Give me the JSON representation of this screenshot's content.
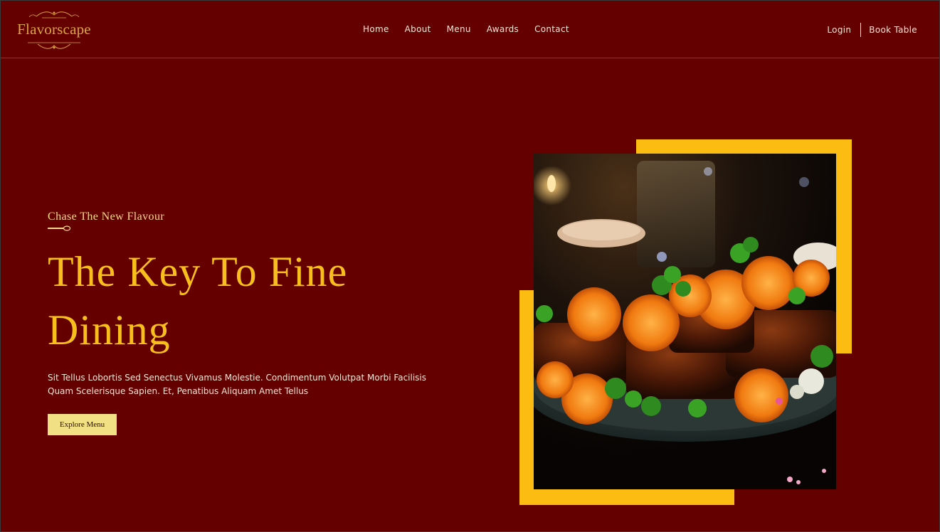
{
  "brand": {
    "name": "Flavorscape"
  },
  "nav": {
    "items": [
      "Home",
      "About",
      "Menu",
      "Awards",
      "Contact"
    ]
  },
  "auth": {
    "login": "Login",
    "book": "Book Table"
  },
  "hero": {
    "tagline": "Chase The New Flavour",
    "title": "The Key To Fine Dining",
    "description": "Sit Tellus Lobortis Sed Senectus Vivamus Molestie. Condimentum Volutpat Morbi Facilisis Quam Scelerisque Sapien. Et, Penatibus Aliquam Amet Tellus",
    "cta": "Explore Menu"
  },
  "colors": {
    "background": "#650000",
    "accent": "#fdbc12",
    "heading": "#f8be1c",
    "button": "#f2e084",
    "logo": "#d9a441"
  },
  "icons": {
    "divider": "spoon-divider-icon",
    "logo_ornament": "flourish-ornament-icon"
  }
}
